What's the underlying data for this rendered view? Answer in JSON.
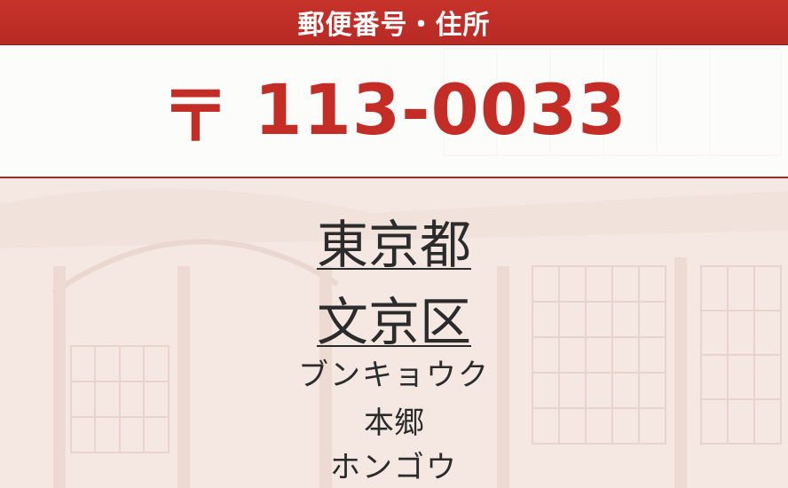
{
  "header": {
    "title": "郵便番号・住所"
  },
  "postal": {
    "mark": "〒",
    "code": "113-0033"
  },
  "address": {
    "prefecture": "東京都",
    "city": "文京区",
    "city_kana": "ブンキョウク",
    "town": "本郷",
    "town_kana": "ホンゴウ"
  },
  "colors": {
    "accent": "#c32d26",
    "header_bg": "#b82a24",
    "text": "#2b2b2b"
  }
}
